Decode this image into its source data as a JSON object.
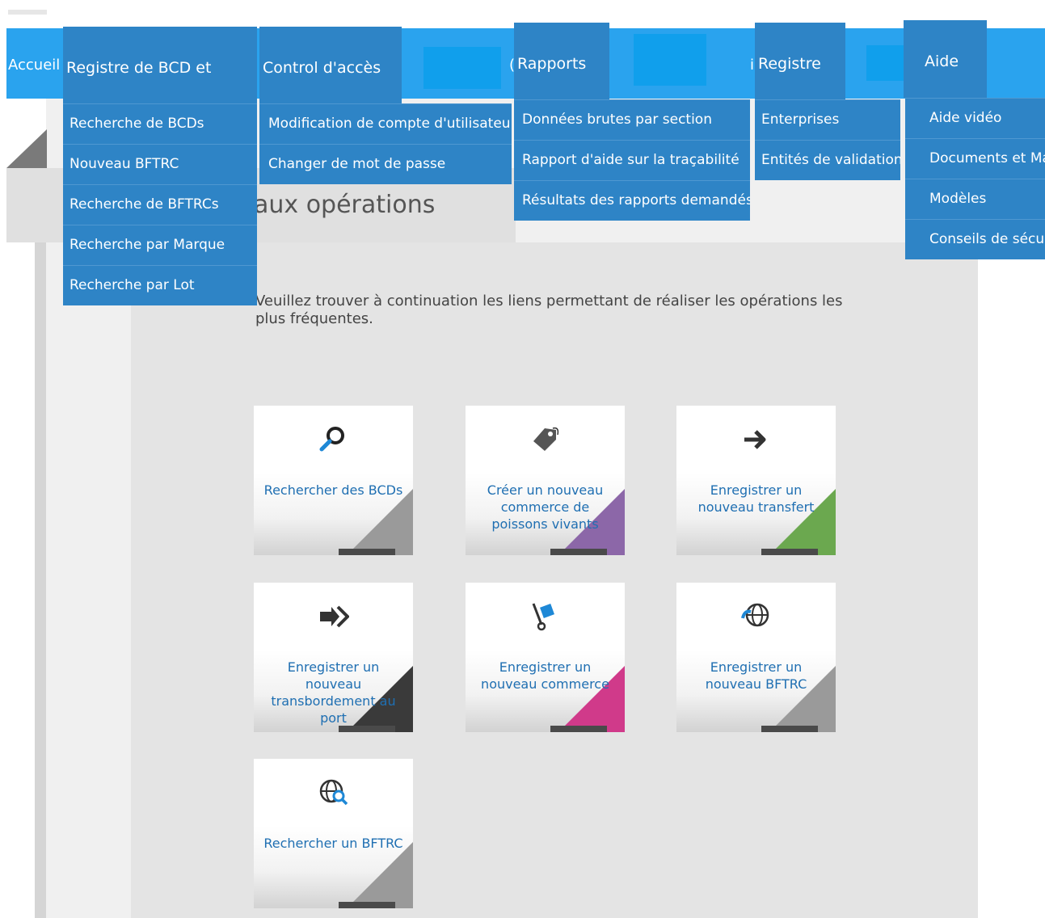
{
  "nav": {
    "accueil": "Accueil",
    "registre_bcd": "Registre de BCD et BFTRC",
    "control": "Control d'accès",
    "rapports": "Rapports",
    "registre": "Registre",
    "aide": "Aide"
  },
  "menus": {
    "registre_bcd": [
      "Recherche de BCDs",
      "Nouveau BFTRC",
      "Recherche de BFTRCs",
      "Recherche par Marque",
      "Recherche par Lot"
    ],
    "control": [
      "Modification de compte d'utilisateur",
      "Changer de mot de passe"
    ],
    "rapports": [
      "Données brutes par section",
      "Rapport d'aide sur la traçabilité",
      "Résultats des rapports demandés"
    ],
    "registre": [
      "Enterprises",
      "Entités de validation"
    ],
    "aide": [
      "Aide vidéo",
      "Documents et Ma",
      "Modèles",
      "Conseils de sécur"
    ]
  },
  "page": {
    "title": "aux opérations",
    "intro": "Veuillez trouver à continuation les liens permettant de réaliser les opérations les plus fréquentes."
  },
  "tiles": [
    {
      "label": "Rechercher des BCDs",
      "icon": "magnifier-icon",
      "accent": "#9a9a9a"
    },
    {
      "label": "Créer un nouveau commerce de poissons vivants",
      "icon": "tag-icon",
      "accent": "#8c67a8"
    },
    {
      "label": "Enregistrer un nouveau transfert",
      "icon": "arrow-right-icon",
      "accent": "#6ba84f"
    },
    {
      "label": "Enregistrer un nouveau transbordement au port",
      "icon": "double-arrow-icon",
      "accent": "#3a3a3a"
    },
    {
      "label": "Enregistrer un nouveau commerce",
      "icon": "hand-truck-icon",
      "accent": "#d03a8a"
    },
    {
      "label": "Enregistrer un nouveau BFTRC",
      "icon": "globe-icon",
      "accent": "#9a9a9a"
    },
    {
      "label": "Rechercher un BFTRC",
      "icon": "globe-search-icon",
      "accent": "#9a9a9a"
    }
  ]
}
